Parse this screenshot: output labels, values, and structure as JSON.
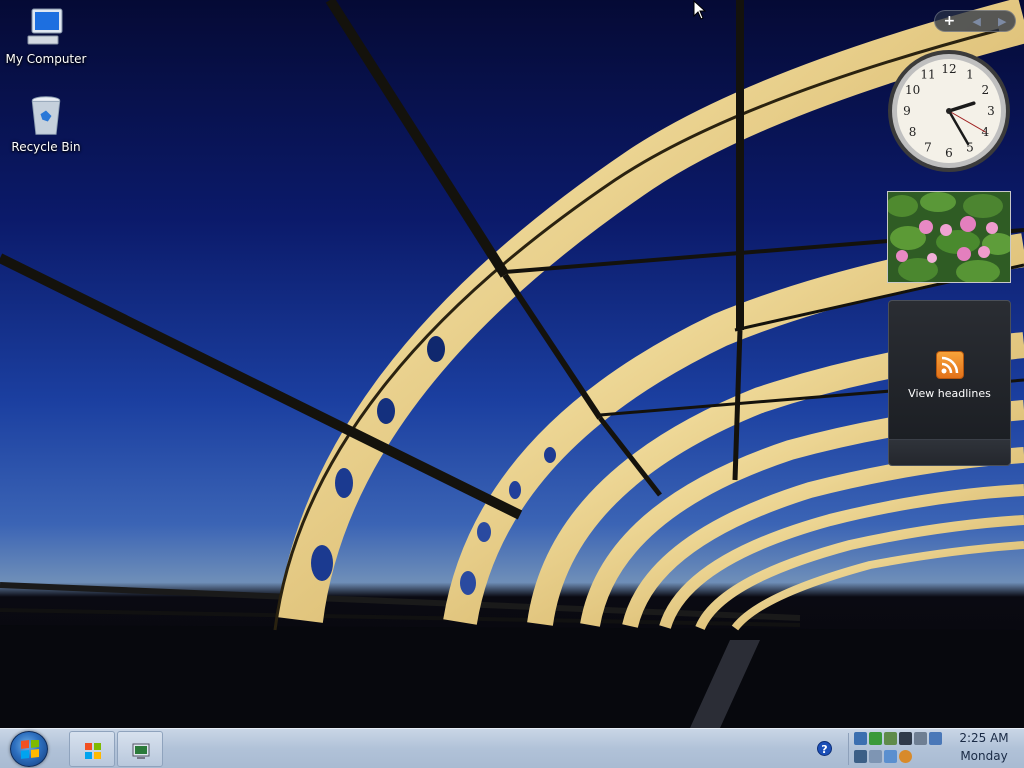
{
  "desktop": {
    "icons": [
      {
        "label": "My Computer",
        "icon": "computer-icon"
      },
      {
        "label": "Recycle Bin",
        "icon": "recycle-bin-icon"
      }
    ]
  },
  "sidebar": {
    "controls": {
      "add_label": "+",
      "prev_label": "◀",
      "next_label": "▶"
    },
    "clock": {
      "hour": 2,
      "minute": 25,
      "second": 20,
      "numerals": [
        "12",
        "1",
        "2",
        "3",
        "4",
        "5",
        "6",
        "7",
        "8",
        "9",
        "10",
        "11"
      ]
    },
    "slideshow": {
      "subject": "pink water lilies"
    },
    "feed": {
      "label": "View headlines",
      "icon": "rss-icon"
    }
  },
  "taskbar": {
    "start_icon": "windows-logo-icon",
    "buttons": [
      {
        "icon": "firefox-icon"
      },
      {
        "icon": "terminal-icon"
      }
    ],
    "tray": {
      "help_label": "?",
      "icons": [
        "network-icon",
        "security-shield-icon",
        "volume-icon",
        "display-icon",
        "printer-icon",
        "monitor-icon",
        "usb-icon",
        "computer-icon",
        "sync-icon",
        "search-icon",
        "",
        ""
      ]
    },
    "clock": {
      "time": "2:25 AM",
      "day": "Monday"
    }
  },
  "colors": {
    "sky_top": "#050a35",
    "sky_mid": "#1b3fa0",
    "bridge": "#f5d98e",
    "taskbar": "#b8c8dc",
    "rss": "#f08a24"
  }
}
